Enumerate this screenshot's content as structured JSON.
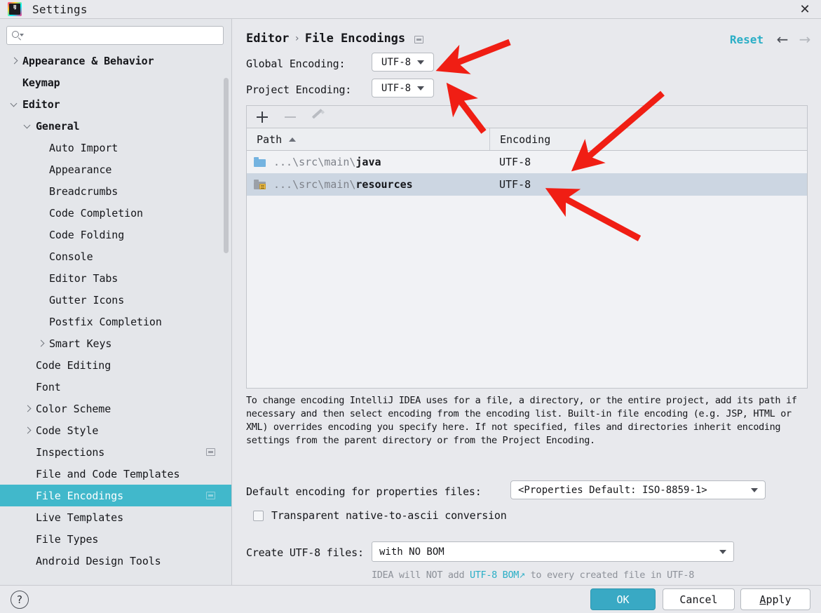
{
  "window": {
    "title": "Settings",
    "logo_text": "IJ",
    "close_label": "✕"
  },
  "sidebar": {
    "search": {
      "value": "",
      "placeholder": ""
    },
    "items": [
      {
        "label": "Appearance & Behavior",
        "depth": 0,
        "chevron": "right",
        "bold": true,
        "selected": false,
        "badge": false
      },
      {
        "label": "Keymap",
        "depth": 0,
        "chevron": "none",
        "bold": true,
        "selected": false,
        "badge": false
      },
      {
        "label": "Editor",
        "depth": 0,
        "chevron": "down",
        "bold": true,
        "selected": false,
        "badge": false
      },
      {
        "label": "General",
        "depth": 1,
        "chevron": "down",
        "bold": true,
        "selected": false,
        "badge": false
      },
      {
        "label": "Auto Import",
        "depth": 2,
        "chevron": "none",
        "bold": false,
        "selected": false,
        "badge": false
      },
      {
        "label": "Appearance",
        "depth": 2,
        "chevron": "none",
        "bold": false,
        "selected": false,
        "badge": false
      },
      {
        "label": "Breadcrumbs",
        "depth": 2,
        "chevron": "none",
        "bold": false,
        "selected": false,
        "badge": false
      },
      {
        "label": "Code Completion",
        "depth": 2,
        "chevron": "none",
        "bold": false,
        "selected": false,
        "badge": false
      },
      {
        "label": "Code Folding",
        "depth": 2,
        "chevron": "none",
        "bold": false,
        "selected": false,
        "badge": false
      },
      {
        "label": "Console",
        "depth": 2,
        "chevron": "none",
        "bold": false,
        "selected": false,
        "badge": false
      },
      {
        "label": "Editor Tabs",
        "depth": 2,
        "chevron": "none",
        "bold": false,
        "selected": false,
        "badge": false
      },
      {
        "label": "Gutter Icons",
        "depth": 2,
        "chevron": "none",
        "bold": false,
        "selected": false,
        "badge": false
      },
      {
        "label": "Postfix Completion",
        "depth": 2,
        "chevron": "none",
        "bold": false,
        "selected": false,
        "badge": false
      },
      {
        "label": "Smart Keys",
        "depth": 2,
        "chevron": "right",
        "bold": false,
        "selected": false,
        "badge": false
      },
      {
        "label": "Code Editing",
        "depth": 1,
        "chevron": "none",
        "bold": false,
        "selected": false,
        "badge": false
      },
      {
        "label": "Font",
        "depth": 1,
        "chevron": "none",
        "bold": false,
        "selected": false,
        "badge": false
      },
      {
        "label": "Color Scheme",
        "depth": 1,
        "chevron": "right",
        "bold": false,
        "selected": false,
        "badge": false
      },
      {
        "label": "Code Style",
        "depth": 1,
        "chevron": "right",
        "bold": false,
        "selected": false,
        "badge": false
      },
      {
        "label": "Inspections",
        "depth": 1,
        "chevron": "none",
        "bold": false,
        "selected": false,
        "badge": true
      },
      {
        "label": "File and Code Templates",
        "depth": 1,
        "chevron": "none",
        "bold": false,
        "selected": false,
        "badge": false
      },
      {
        "label": "File Encodings",
        "depth": 1,
        "chevron": "none",
        "bold": false,
        "selected": true,
        "badge": true
      },
      {
        "label": "Live Templates",
        "depth": 1,
        "chevron": "none",
        "bold": false,
        "selected": false,
        "badge": false
      },
      {
        "label": "File Types",
        "depth": 1,
        "chevron": "none",
        "bold": false,
        "selected": false,
        "badge": false
      },
      {
        "label": "Android Design Tools",
        "depth": 1,
        "chevron": "none",
        "bold": false,
        "selected": false,
        "badge": false
      }
    ]
  },
  "main": {
    "breadcrumb": {
      "root": "Editor",
      "separator": "›",
      "leaf": "File Encodings"
    },
    "reset_label": "Reset",
    "nav_back": "←",
    "nav_forward": "→",
    "global_encoding": {
      "label": "Global Encoding:",
      "value": "UTF-8"
    },
    "project_encoding": {
      "label": "Project Encoding:",
      "value": "UTF-8"
    },
    "table": {
      "toolbar": {
        "add": "+",
        "remove": "−",
        "edit": "pencil"
      },
      "columns": [
        "Path",
        "Encoding"
      ],
      "sort_column": "Path",
      "sort_direction": "ascending",
      "rows": [
        {
          "path_prefix": "...\\src\\main\\",
          "path_leaf": "java",
          "encoding": "UTF-8",
          "icon": "folder-blue",
          "selected": false
        },
        {
          "path_prefix": "...\\src\\main\\",
          "path_leaf": "resources",
          "encoding": "UTF-8",
          "icon": "folder-resources",
          "selected": true
        }
      ]
    },
    "description": "To change encoding IntelliJ IDEA uses for a file, a directory, or the entire project, add its path if necessary and then select encoding from the encoding list. Built-in file encoding (e.g. JSP, HTML or XML) overrides encoding you specify here. If not specified, files and directories inherit encoding settings from the parent directory or from the Project Encoding.",
    "properties_encoding": {
      "label": "Default encoding for properties files:",
      "value": "<Properties Default: ISO-8859-1>"
    },
    "transparent_checkbox": {
      "label": "Transparent native-to-ascii conversion",
      "checked": false
    },
    "create_utf8": {
      "label": "Create UTF-8 files:",
      "value": "with NO BOM"
    },
    "bom_note": {
      "before": "IDEA will NOT add ",
      "link": "UTF-8 BOM",
      "link_arrow": "↗",
      "after": " to every created file in UTF-8"
    }
  },
  "footer": {
    "help": "?",
    "ok": "OK",
    "cancel": "Cancel",
    "apply_first": "A",
    "apply_rest": "pply"
  },
  "colors": {
    "accent_teal": "#41b8cb",
    "link_teal": "#2aaec6",
    "ok_button": "#39a9c4",
    "row_selected": "#ccd6e2",
    "annotation_red": "#f01e14"
  }
}
